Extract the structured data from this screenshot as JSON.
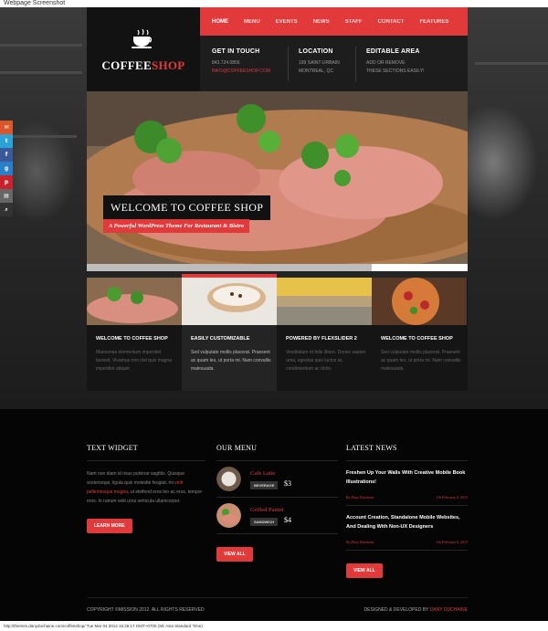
{
  "screenshot_label": "Webpage Screenshot",
  "brand": {
    "name_part1": "COFFEE",
    "name_part2": "SHOP",
    "accent": "#e23a3a"
  },
  "nav": [
    "HOME",
    "MENU",
    "EVENTS",
    "NEWS",
    "STAFF",
    "CONTACT",
    "FEATURES"
  ],
  "info": [
    {
      "title": "GET IN TOUCH",
      "lines": [
        "843.724.0856"
      ],
      "email": "INFO@COFFEESHOP.COM"
    },
    {
      "title": "LOCATION",
      "lines": [
        "199 SAINT-URBAIN",
        "MONTREAL, QC"
      ]
    },
    {
      "title": "EDITABLE AREA",
      "lines": [
        "ADD OR REMOVE",
        "THESE SECTIONS EASILY!"
      ]
    }
  ],
  "social_icons": [
    "email-icon",
    "twitter-icon",
    "facebook-icon",
    "google-plus-icon",
    "pinterest-icon",
    "mail-icon",
    "search-icon"
  ],
  "hero": {
    "title": "WELCOME TO COFFEE SHOP",
    "tagline": "A Powerful WordPress Theme For Restaurant & Bistro"
  },
  "features": [
    {
      "title": "WELCOME TO COFFEE SHOP",
      "text": "Maecenas elementum imperdiet laoreet. Vivamus non nisl quis magna imperdiet aliquet."
    },
    {
      "title": "EASILY CUSTOMIZABLE",
      "text": "Sed vulputate mollis placerat. Praesent ac quam leo, ut porta mi. Nam convallis malesuada."
    },
    {
      "title": "POWERED BY FLEXSLIDER 2",
      "text": "Vestibulum et felis libero. Donec sapien urna, egestas quis luctus at, condimentum ac dolor."
    },
    {
      "title": "WELCOME TO COFFEE SHOP",
      "text": "Sed vulputate mollis placerat. Praesent ac quam leo, ut porta mi. Nam convallis malesuada."
    }
  ],
  "text_widget": {
    "heading": "TEXT WIDGET",
    "text_before": "Nam non diam id risus pulvinar sagittis. Quisque scelerisque, ligula quis molestie feugiat, mi ",
    "link": "velit pellentesque magna",
    "text_after": ", ut eleifend eros leo ac eros. tempor eros. In rutrum velit urna vehicula ullamcorper.",
    "button": "LEARN MORE"
  },
  "our_menu": {
    "heading": "OUR MENU",
    "items": [
      {
        "name": "Cafe Latte",
        "tag": "BEVERAGE",
        "price": "$3"
      },
      {
        "name": "Grilled Panini",
        "tag": "SANDWICH",
        "price": "$4"
      }
    ],
    "button": "VIEW ALL"
  },
  "latest_news": {
    "heading": "LATEST NEWS",
    "items": [
      {
        "title": "Freshen Up Your Walls With Creative Mobile Book Illustrations!",
        "author": "By Dany Duchaine",
        "date": "On February 6, 2013"
      },
      {
        "title": "Account Creation, Standalone Mobile Websites, And Dealing With Non-UX Designers",
        "author": "By Dany Duchaine",
        "date": "On February 6, 2013"
      }
    ],
    "button": "VIEW ALL"
  },
  "footer": {
    "copyright": "COPYRIGHT ©MISSION 2012. ALL RIGHTS RESERVED",
    "credit_prefix": "DESIGNED & DEVELOPED BY ",
    "credit_name": "DANY DUCHAINE"
  },
  "status_bar": "http://themes.danyduchaine.com/coffeeshop/ Tue Mar 04 2014 15:26:17 GMT+0700 (SE Asia Standard Time)"
}
